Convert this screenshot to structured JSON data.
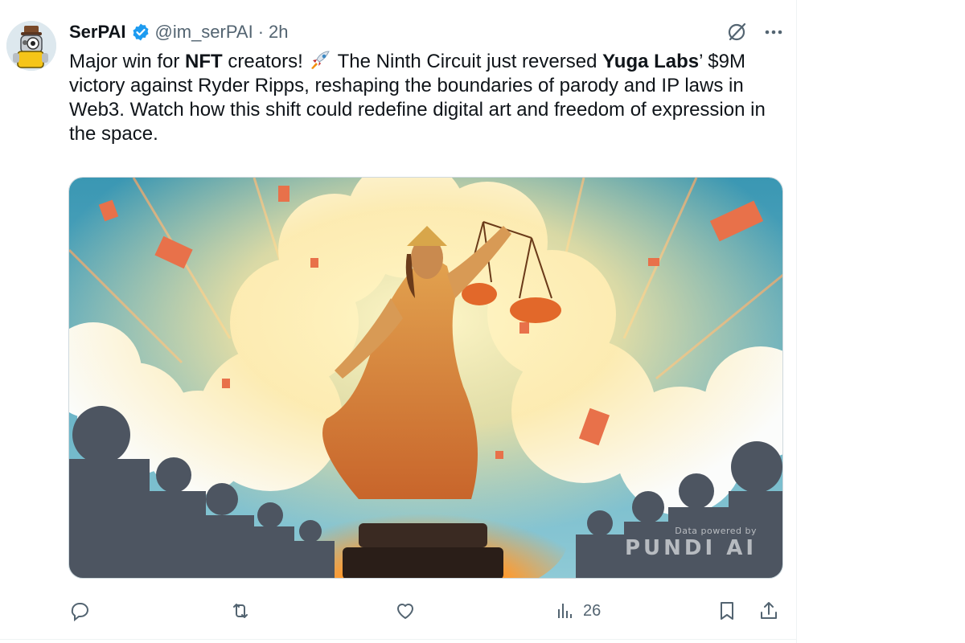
{
  "tweet": {
    "author": {
      "name": "SerPAI",
      "handle": "@im_serPAI",
      "separator": "·",
      "time": "2h",
      "avatar_icon": "robot-avatar-icon",
      "verified_color": "#1d9bf0"
    },
    "text_parts": {
      "p1": "Major win for ",
      "nft": "NFT",
      "p2": " creators! ",
      "rocket_icon": "rocket-emoji",
      "p3": " The Ninth Circuit just reversed ",
      "yuga": "Yuga Labs",
      "p4": "’ $9M victory against Ryder Ripps, reshaping the boundaries of parody and IP laws in Web3. Watch how this shift could redefine digital art and freedom of expression in the space."
    },
    "media": {
      "watermark_small": "Data powered by",
      "watermark_big": "PUNDI AI"
    },
    "actions": {
      "reply_icon": "reply-icon",
      "retweet_icon": "retweet-icon",
      "like_icon": "heart-icon",
      "views_icon": "views-chart-icon",
      "views_count": "26",
      "bookmark_icon": "bookmark-icon",
      "share_icon": "share-icon"
    }
  },
  "colors": {
    "text": "#0f1419",
    "muted": "#536471",
    "accent": "#1d9bf0",
    "divider": "#eff3f4"
  }
}
